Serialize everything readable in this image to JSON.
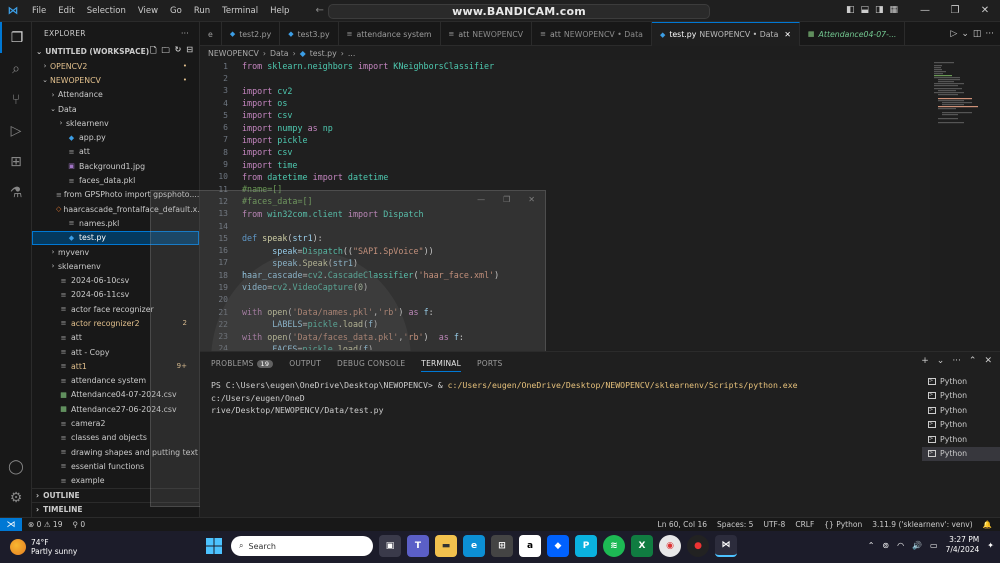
{
  "window": {
    "watermark": "www.BANDICAM.com",
    "menu": [
      "File",
      "Edit",
      "Selection",
      "View",
      "Go",
      "Run",
      "Terminal",
      "Help"
    ]
  },
  "sidebar": {
    "title": "EXPLORER",
    "workspace": "UNTITLED (WORKSPACE)",
    "items": [
      {
        "label": "OPENCV2",
        "indent": 1,
        "chev": "›",
        "icon": "",
        "color": "#e2c08d",
        "badge": "•",
        "badge_color": "#e2c08d"
      },
      {
        "label": "NEWOPENCV",
        "indent": 1,
        "chev": "⌄",
        "icon": "",
        "color": "#e2c08d",
        "badge": "•",
        "badge_color": "#e2c08d"
      },
      {
        "label": "Attendance",
        "indent": 2,
        "chev": "›",
        "icon": "",
        "color": "#cccccc",
        "badge": "",
        "badge_color": ""
      },
      {
        "label": "Data",
        "indent": 2,
        "chev": "⌄",
        "icon": "",
        "color": "#cccccc",
        "badge": "",
        "badge_color": ""
      },
      {
        "label": "sklearnenv",
        "indent": 3,
        "chev": "›",
        "icon": "",
        "color": "#cccccc",
        "badge": "",
        "badge_color": ""
      },
      {
        "label": "app.py",
        "indent": 3,
        "chev": "",
        "icon": "py",
        "color": "#cccccc",
        "badge": "",
        "badge_color": ""
      },
      {
        "label": "att",
        "indent": 3,
        "chev": "",
        "icon": "≡",
        "color": "#cccccc",
        "badge": "",
        "badge_color": ""
      },
      {
        "label": "Background1.jpg",
        "indent": 3,
        "chev": "",
        "icon": "img",
        "color": "#cccccc",
        "badge": "",
        "badge_color": ""
      },
      {
        "label": "faces_data.pkl",
        "indent": 3,
        "chev": "",
        "icon": "≡",
        "color": "#cccccc",
        "badge": "",
        "badge_color": ""
      },
      {
        "label": "from GPSPhoto import gpsphoto....",
        "indent": 3,
        "chev": "",
        "icon": "≡",
        "color": "#cccccc",
        "badge": "",
        "badge_color": ""
      },
      {
        "label": "haarcascade_frontalface_default.x...",
        "indent": 3,
        "chev": "",
        "icon": "xml",
        "color": "#cccccc",
        "badge": "",
        "badge_color": ""
      },
      {
        "label": "names.pkl",
        "indent": 3,
        "chev": "",
        "icon": "≡",
        "color": "#cccccc",
        "badge": "",
        "badge_color": ""
      },
      {
        "label": "test.py",
        "indent": 3,
        "chev": "",
        "icon": "py",
        "color": "#ffffff",
        "badge": "",
        "badge_color": "",
        "selected": true
      },
      {
        "label": "myvenv",
        "indent": 2,
        "chev": "›",
        "icon": "",
        "color": "#cccccc",
        "badge": "",
        "badge_color": ""
      },
      {
        "label": "sklearnenv",
        "indent": 2,
        "chev": "›",
        "icon": "",
        "color": "#cccccc",
        "badge": "",
        "badge_color": ""
      },
      {
        "label": "2024-06-10csv",
        "indent": 2,
        "chev": "",
        "icon": "≡",
        "color": "#cccccc",
        "badge": "",
        "badge_color": ""
      },
      {
        "label": "2024-06-11csv",
        "indent": 2,
        "chev": "",
        "icon": "≡",
        "color": "#cccccc",
        "badge": "",
        "badge_color": ""
      },
      {
        "label": "actor face recognizer",
        "indent": 2,
        "chev": "",
        "icon": "≡",
        "color": "#cccccc",
        "badge": "",
        "badge_color": ""
      },
      {
        "label": "actor recognizer2",
        "indent": 2,
        "chev": "",
        "icon": "≡",
        "color": "#e2c08d",
        "badge": "2",
        "badge_color": "#e2c08d"
      },
      {
        "label": "att",
        "indent": 2,
        "chev": "",
        "icon": "≡",
        "color": "#cccccc",
        "badge": "",
        "badge_color": ""
      },
      {
        "label": "att - Copy",
        "indent": 2,
        "chev": "",
        "icon": "≡",
        "color": "#cccccc",
        "badge": "",
        "badge_color": ""
      },
      {
        "label": "att1",
        "indent": 2,
        "chev": "",
        "icon": "≡",
        "color": "#e2c08d",
        "badge": "9+",
        "badge_color": "#e2c08d"
      },
      {
        "label": "attendance system",
        "indent": 2,
        "chev": "",
        "icon": "≡",
        "color": "#cccccc",
        "badge": "",
        "badge_color": ""
      },
      {
        "label": "Attendance04-07-2024.csv",
        "indent": 2,
        "chev": "",
        "icon": "csv",
        "color": "#cccccc",
        "badge": "",
        "badge_color": ""
      },
      {
        "label": "Attendance27-06-2024.csv",
        "indent": 2,
        "chev": "",
        "icon": "csv",
        "color": "#cccccc",
        "badge": "",
        "badge_color": ""
      },
      {
        "label": "camera2",
        "indent": 2,
        "chev": "",
        "icon": "≡",
        "color": "#cccccc",
        "badge": "",
        "badge_color": ""
      },
      {
        "label": "classes and objects",
        "indent": 2,
        "chev": "",
        "icon": "≡",
        "color": "#cccccc",
        "badge": "",
        "badge_color": ""
      },
      {
        "label": "drawing shapes and putting text",
        "indent": 2,
        "chev": "",
        "icon": "≡",
        "color": "#cccccc",
        "badge": "",
        "badge_color": ""
      },
      {
        "label": "essential functions",
        "indent": 2,
        "chev": "",
        "icon": "≡",
        "color": "#cccccc",
        "badge": "",
        "badge_color": ""
      },
      {
        "label": "example",
        "indent": 2,
        "chev": "",
        "icon": "≡",
        "color": "#cccccc",
        "badge": "",
        "badge_color": ""
      }
    ],
    "outline": "OUTLINE",
    "timeline": "TIMELINE"
  },
  "tabs": [
    {
      "label": "e",
      "desc": "",
      "active": false,
      "italic": false
    },
    {
      "label": "test2.py",
      "desc": "",
      "active": false,
      "italic": false
    },
    {
      "label": "test3.py",
      "desc": "",
      "active": false,
      "italic": false
    },
    {
      "label": "attendance system",
      "desc": "",
      "active": false,
      "italic": false
    },
    {
      "label": "att",
      "desc": "NEWOPENCV",
      "active": false,
      "italic": false
    },
    {
      "label": "att",
      "desc": "NEWOPENCV • Data",
      "active": false,
      "italic": false
    },
    {
      "label": "test.py",
      "desc": "NEWOPENCV • Data",
      "active": true,
      "italic": false
    },
    {
      "label": "Attendance04-07-...",
      "desc": "",
      "active": false,
      "italic": true
    }
  ],
  "breadcrumb": [
    "NEWOPENCV",
    "Data",
    "test.py",
    "..."
  ],
  "code": [
    {
      "n": "1",
      "t": [
        [
          "kw",
          "from "
        ],
        [
          "mod",
          "sklearn.neighbors "
        ],
        [
          "kw",
          "import "
        ],
        [
          "mod",
          "KNeighborsClassifier"
        ]
      ]
    },
    {
      "n": "2",
      "t": []
    },
    {
      "n": "3",
      "t": [
        [
          "kw",
          "import "
        ],
        [
          "mod",
          "cv2"
        ]
      ]
    },
    {
      "n": "4",
      "t": [
        [
          "kw",
          "import "
        ],
        [
          "mod",
          "os"
        ]
      ]
    },
    {
      "n": "5",
      "t": [
        [
          "kw",
          "import "
        ],
        [
          "mod",
          "csv"
        ]
      ]
    },
    {
      "n": "6",
      "t": [
        [
          "kw",
          "import "
        ],
        [
          "mod",
          "numpy "
        ],
        [
          "kw",
          "as "
        ],
        [
          "mod",
          "np"
        ]
      ]
    },
    {
      "n": "7",
      "t": [
        [
          "kw",
          "import "
        ],
        [
          "mod",
          "pickle"
        ]
      ]
    },
    {
      "n": "8",
      "t": [
        [
          "kw",
          "import "
        ],
        [
          "mod",
          "csv"
        ]
      ]
    },
    {
      "n": "9",
      "t": [
        [
          "kw",
          "import "
        ],
        [
          "mod",
          "time"
        ]
      ]
    },
    {
      "n": "10",
      "t": [
        [
          "kw",
          "from "
        ],
        [
          "mod",
          "datetime "
        ],
        [
          "kw",
          "import "
        ],
        [
          "mod",
          "datetime"
        ]
      ]
    },
    {
      "n": "11",
      "t": [
        [
          "cm",
          "#name=[]"
        ]
      ]
    },
    {
      "n": "12",
      "t": [
        [
          "cm",
          "#faces_data=[]"
        ]
      ]
    },
    {
      "n": "13",
      "t": [
        [
          "kw",
          "from "
        ],
        [
          "mod",
          "win32com.client "
        ],
        [
          "kw",
          "import "
        ],
        [
          "mod",
          "Dispatch"
        ]
      ]
    },
    {
      "n": "14",
      "t": []
    },
    {
      "n": "15",
      "t": [
        [
          "def",
          "def "
        ],
        [
          "fn",
          "speak"
        ],
        [
          "pl",
          "("
        ],
        [
          "var",
          "str1"
        ],
        [
          "pl",
          "):"
        ]
      ]
    },
    {
      "n": "16",
      "t": [
        [
          "pl",
          "      "
        ],
        [
          "var",
          "speak"
        ],
        [
          "pl",
          "="
        ],
        [
          "mod",
          "Dispatch"
        ],
        [
          "pl",
          "(("
        ],
        [
          "str",
          "\"SAPI.SpVoice\""
        ],
        [
          "pl",
          "))"
        ]
      ]
    },
    {
      "n": "17",
      "t": [
        [
          "pl",
          "      "
        ],
        [
          "var",
          "speak"
        ],
        [
          "pl",
          "."
        ],
        [
          "fn",
          "Speak"
        ],
        [
          "pl",
          "("
        ],
        [
          "var",
          "str1"
        ],
        [
          "pl",
          ")"
        ]
      ]
    },
    {
      "n": "18",
      "t": [
        [
          "var",
          "haar_cascade"
        ],
        [
          "pl",
          "="
        ],
        [
          "mod",
          "cv2"
        ],
        [
          "pl",
          "."
        ],
        [
          "mod",
          "CascadeClassifier"
        ],
        [
          "pl",
          "("
        ],
        [
          "str",
          "'haar_face.xml'"
        ],
        [
          "pl",
          ")"
        ]
      ]
    },
    {
      "n": "19",
      "t": [
        [
          "var",
          "video"
        ],
        [
          "pl",
          "="
        ],
        [
          "mod",
          "cv2"
        ],
        [
          "pl",
          "."
        ],
        [
          "mod",
          "VideoCapture"
        ],
        [
          "pl",
          "("
        ],
        [
          "num",
          "0"
        ],
        [
          "pl",
          ")"
        ]
      ]
    },
    {
      "n": "20",
      "t": []
    },
    {
      "n": "21",
      "t": [
        [
          "kw",
          "with "
        ],
        [
          "fn",
          "open"
        ],
        [
          "pl",
          "("
        ],
        [
          "str",
          "'Data/names.pkl'"
        ],
        [
          "pl",
          ","
        ],
        [
          "str",
          "'rb'"
        ],
        [
          "pl",
          ") "
        ],
        [
          "kw",
          "as "
        ],
        [
          "var",
          "f"
        ],
        [
          "pl",
          ":"
        ]
      ]
    },
    {
      "n": "22",
      "t": [
        [
          "pl",
          "      "
        ],
        [
          "var",
          "LABELS"
        ],
        [
          "pl",
          "="
        ],
        [
          "mod",
          "pickle"
        ],
        [
          "pl",
          "."
        ],
        [
          "fn",
          "load"
        ],
        [
          "pl",
          "("
        ],
        [
          "var",
          "f"
        ],
        [
          "pl",
          ")"
        ]
      ]
    },
    {
      "n": "23",
      "t": [
        [
          "kw",
          "with "
        ],
        [
          "fn",
          "open"
        ],
        [
          "pl",
          "("
        ],
        [
          "str",
          "'Data/faces_data.pkl'"
        ],
        [
          "pl",
          ","
        ],
        [
          "str",
          "'rb'"
        ],
        [
          "pl",
          ")  "
        ],
        [
          "kw",
          "as "
        ],
        [
          "var",
          "f"
        ],
        [
          "pl",
          ":"
        ]
      ]
    },
    {
      "n": "24",
      "t": [
        [
          "pl",
          "      "
        ],
        [
          "var",
          "FACES"
        ],
        [
          "pl",
          "="
        ],
        [
          "mod",
          "pickle"
        ],
        [
          "pl",
          "."
        ],
        [
          "fn",
          "load"
        ],
        [
          "pl",
          "("
        ],
        [
          "var",
          "f"
        ],
        [
          "pl",
          ")"
        ]
      ]
    }
  ],
  "panel": {
    "tabs": [
      {
        "label": "PROBLEMS",
        "badge": "19",
        "active": false
      },
      {
        "label": "OUTPUT",
        "badge": "",
        "active": false
      },
      {
        "label": "DEBUG CONSOLE",
        "badge": "",
        "active": false
      },
      {
        "label": "TERMINAL",
        "badge": "",
        "active": true
      },
      {
        "label": "PORTS",
        "badge": "",
        "active": false
      }
    ],
    "terminal_prompt": "PS C:\\Users\\eugen\\OneDrive\\Desktop\\NEWOPENCV> & ",
    "terminal_path1": "c:/Users/eugen/OneDrive/Desktop/NEWOPENCV/sklearnenv/Scripts/python.exe",
    "terminal_path2": " c:/Users/eugen/OneD",
    "terminal_line2": "rive/Desktop/NEWOPENCV/Data/test.py",
    "terminals": [
      "Python",
      "Python",
      "Python",
      "Python",
      "Python",
      "Python"
    ]
  },
  "statusbar": {
    "problems": "⊗ 0 ⚠ 19",
    "ports": "⚲ 0",
    "position": "Ln 60, Col 16",
    "spaces": "Spaces: 5",
    "encoding": "UTF-8",
    "eol": "CRLF",
    "language": "{} Python",
    "interpreter": "3.11.9 ('sklearnenv': venv)"
  },
  "taskbar": {
    "temp": "74°F",
    "weather": "Partly sunny",
    "search_placeholder": "Search",
    "time": "3:27 PM",
    "date": "7/4/2024"
  }
}
